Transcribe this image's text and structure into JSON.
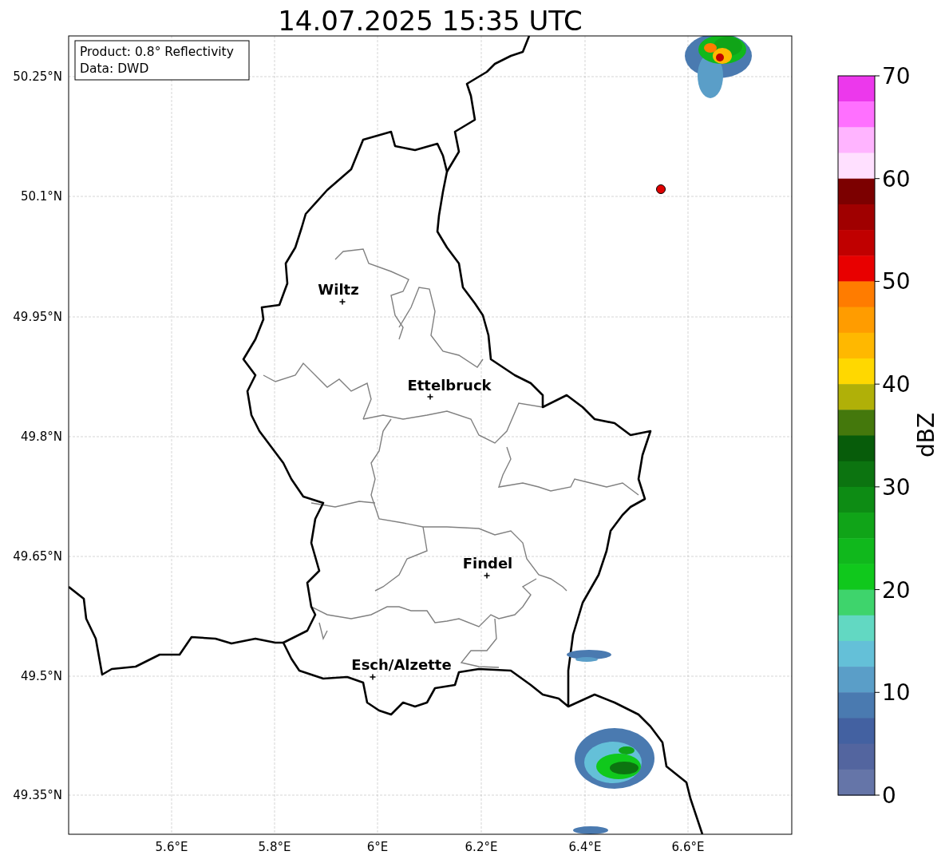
{
  "title": "14.07.2025 15:35 UTC",
  "info_box": [
    "Product: 0.8° Reflectivity",
    "Data: DWD"
  ],
  "map": {
    "xticks": [
      "5.6°E",
      "5.8°E",
      "6°E",
      "6.2°E",
      "6.4°E",
      "6.6°E"
    ],
    "yticks": [
      "50.25°N",
      "50.1°N",
      "49.95°N",
      "49.8°N",
      "49.65°N",
      "49.5°N",
      "49.35°N"
    ],
    "places": [
      {
        "name": "Wiltz"
      },
      {
        "name": "Ettelbruck"
      },
      {
        "name": "Findel"
      },
      {
        "name": "Esch/Alzette"
      }
    ]
  },
  "colorbar": {
    "label": "dBZ",
    "ticks": [
      "70",
      "60",
      "50",
      "40",
      "30",
      "20",
      "10",
      "0"
    ],
    "bins": [
      {
        "color": "#ec38ec"
      },
      {
        "color": "#ff70ff"
      },
      {
        "color": "#ffb4ff"
      },
      {
        "color": "#ffe0ff"
      },
      {
        "color": "#7c0000"
      },
      {
        "color": "#a00000"
      },
      {
        "color": "#c00000"
      },
      {
        "color": "#e80000"
      },
      {
        "color": "#ff7c00"
      },
      {
        "color": "#ff9c00"
      },
      {
        "color": "#ffb800"
      },
      {
        "color": "#ffd800"
      },
      {
        "color": "#b0b008"
      },
      {
        "color": "#44780c"
      },
      {
        "color": "#075c0a"
      },
      {
        "color": "#0c7410"
      },
      {
        "color": "#0d8c14"
      },
      {
        "color": "#10a418"
      },
      {
        "color": "#10b81c"
      },
      {
        "color": "#10c81c"
      },
      {
        "color": "#3ed46c"
      },
      {
        "color": "#62d8c2"
      },
      {
        "color": "#64c0d8"
      },
      {
        "color": "#5a9ec8"
      },
      {
        "color": "#4a7ab0"
      },
      {
        "color": "#4361a1"
      },
      {
        "color": "#53659f"
      },
      {
        "color": "#6575a8"
      }
    ]
  }
}
